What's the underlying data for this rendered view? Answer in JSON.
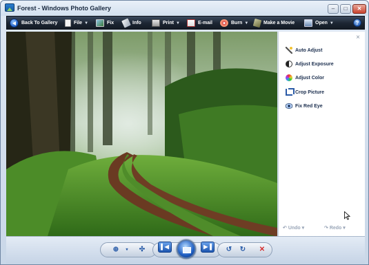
{
  "window": {
    "title": "Forest - Windows Photo Gallery",
    "controls": {
      "minimize": "–",
      "maximize": "□",
      "close": "✕"
    }
  },
  "toolbar": {
    "items": [
      {
        "label": "Back To Gallery",
        "icon": "back-arrow-icon",
        "dropdown": false
      },
      {
        "label": "File",
        "icon": "file-icon",
        "dropdown": true
      },
      {
        "label": "Fix",
        "icon": "fix-icon",
        "dropdown": false
      },
      {
        "label": "Info",
        "icon": "info-icon",
        "dropdown": false
      },
      {
        "label": "Print",
        "icon": "print-icon",
        "dropdown": true
      },
      {
        "label": "E-mail",
        "icon": "email-icon",
        "dropdown": false
      },
      {
        "label": "Burn",
        "icon": "burn-icon",
        "dropdown": true
      },
      {
        "label": "Make a Movie",
        "icon": "movie-icon",
        "dropdown": false
      },
      {
        "label": "Open",
        "icon": "open-icon",
        "dropdown": true
      }
    ],
    "help": "?"
  },
  "fix_panel": {
    "close": "×",
    "items": [
      {
        "label": "Auto Adjust",
        "icon": "magic-wand-icon"
      },
      {
        "label": "Adjust Exposure",
        "icon": "exposure-icon"
      },
      {
        "label": "Adjust Color",
        "icon": "color-wheel-icon"
      },
      {
        "label": "Crop Picture",
        "icon": "crop-icon"
      },
      {
        "label": "Fix Red Eye",
        "icon": "red-eye-icon"
      }
    ],
    "undo": "Undo",
    "redo": "Redo"
  },
  "controls": {
    "zoom": "zoom-icon",
    "actual_size": "actual-size-icon",
    "previous": "previous-icon",
    "slideshow": "slideshow-icon",
    "next": "next-icon",
    "rotate_ccw": "rotate-counterclockwise-icon",
    "rotate_cw": "rotate-clockwise-icon",
    "delete": "delete-icon"
  },
  "colors": {
    "toolbar_dark": "#1c2532",
    "accent_blue": "#1f5fc4",
    "panel_text": "#1a2d4d",
    "delete_red": "#d62b2b"
  }
}
